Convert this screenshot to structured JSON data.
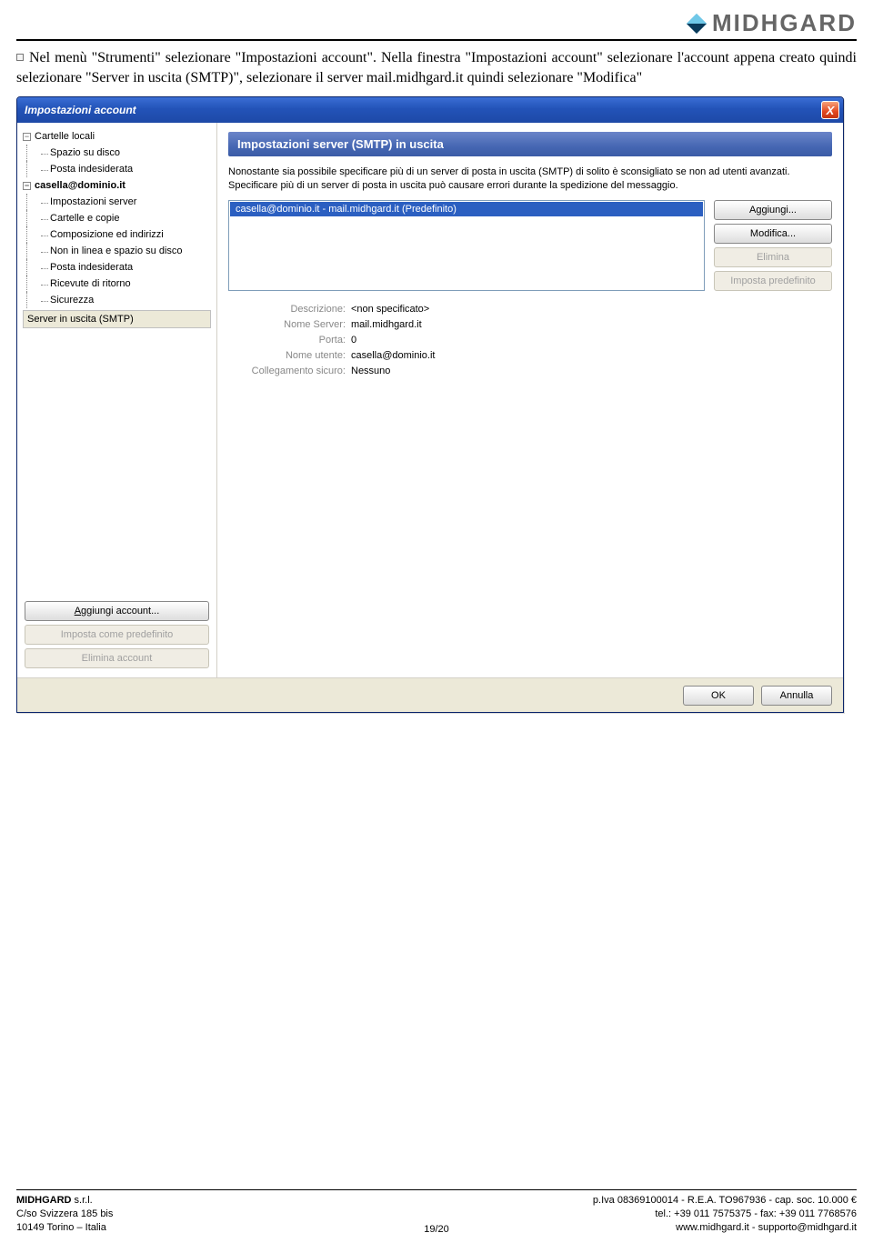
{
  "header": {
    "logo_text": "MIDHGARD"
  },
  "body_text": "Nel menù \"Strumenti\" selezionare \"Impostazioni account\". Nella finestra \"Impostazioni account\" selezionare l'account appena creato quindi selezionare \"Server in uscita (SMTP)\", selezionare il server mail.midhgard.it quindi selezionare \"Modifica\"",
  "dialog": {
    "title": "Impostazioni account",
    "close_x": "X",
    "tree": {
      "local_folders": "Cartelle locali",
      "disk_space": "Spazio su disco",
      "junk1": "Posta indesiderata",
      "account": "casella@dominio.it",
      "server_settings": "Impostazioni server",
      "copies": "Cartelle e copie",
      "compose": "Composizione ed indirizzi",
      "offline": "Non in linea e spazio su disco",
      "junk2": "Posta indesiderata",
      "receipts": "Ricevute di ritorno",
      "security": "Sicurezza",
      "smtp": "Server in uscita (SMTP)"
    },
    "left_buttons": {
      "add": "Aggiungi account...",
      "default": "Imposta come predefinito",
      "delete": "Elimina account"
    },
    "section_title": "Impostazioni server (SMTP) in uscita",
    "info": "Nonostante sia possibile specificare più di un server di posta in uscita (SMTP) di solito è sconsigliato se non ad utenti avanzati. Specificare più di un server di posta in uscita può causare errori durante la spedizione del messaggio.",
    "server_list_item": "casella@dominio.it - mail.midhgard.it (Predefinito)",
    "side_buttons": {
      "add": "Aggiungi...",
      "edit": "Modifica...",
      "delete": "Elimina",
      "default": "Imposta predefinito"
    },
    "details": {
      "desc_label": "Descrizione:",
      "desc_value": "<non specificato>",
      "server_label": "Nome Server:",
      "server_value": "mail.midhgard.it",
      "port_label": "Porta:",
      "port_value": "0",
      "user_label": "Nome utente:",
      "user_value": "casella@dominio.it",
      "secure_label": "Collegamento sicuro:",
      "secure_value": "Nessuno"
    },
    "footer": {
      "ok": "OK",
      "cancel": "Annulla"
    }
  },
  "page_footer": {
    "company": "MIDHGARD",
    "company_suffix": " s.r.l.",
    "addr1": "C/so Svizzera 185 bis",
    "addr2": "10149 Torino – Italia",
    "pagenum": "19/20",
    "piva": "p.Iva 08369100014 - R.E.A. TO967936 - cap. soc. 10.000 €",
    "tel": "tel.: +39 011 7575375 - fax: +39 011 7768576",
    "web": "www.midhgard.it  -  supporto@midhgard.it"
  }
}
